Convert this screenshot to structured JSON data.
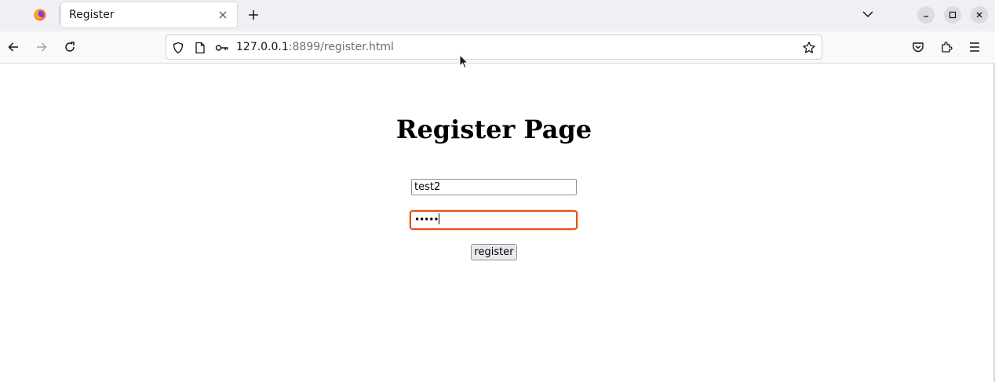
{
  "browser": {
    "tab": {
      "title": "Register",
      "close_icon": "close-icon"
    },
    "url": {
      "host": "127.0.0.1",
      "rest": ":8899/register.html"
    },
    "icons": [
      "firefox-logo-icon",
      "new-tab-icon",
      "tab-list-icon",
      "minimize-icon",
      "maximize-icon",
      "close-window-icon",
      "back-icon",
      "forward-icon",
      "reload-icon",
      "shield-icon",
      "page-icon",
      "key-icon",
      "bookmark-star-icon",
      "pocket-icon",
      "extensions-icon",
      "menu-icon"
    ],
    "colors": {
      "tabstrip": "#f0f0f4",
      "navbar": "#f9f9fb",
      "focus_ring": "#e5521e"
    }
  },
  "page": {
    "title": "Register Page",
    "username": {
      "value": "test2"
    },
    "password": {
      "masked_value": "•••••"
    },
    "register_label": "register"
  }
}
